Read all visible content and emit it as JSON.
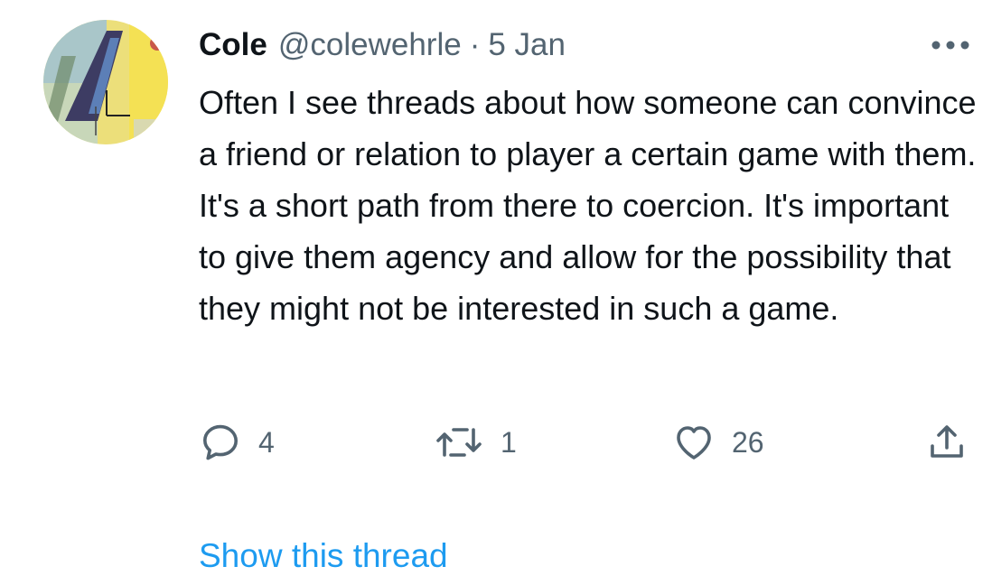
{
  "tweet": {
    "author_name": "Cole",
    "handle": "@colewehrle",
    "separator": "·",
    "timestamp": "5 Jan",
    "text": "Often I see threads about how someone can convince a friend or relation to player a certain game with them. It's a short path from there to coercion. It's important to give them agency and allow for the possibility that they might not be interested in such a game."
  },
  "actions": {
    "reply": {
      "icon": "reply-icon",
      "count": "4"
    },
    "retweet": {
      "icon": "retweet-icon",
      "count": "1"
    },
    "like": {
      "icon": "heart-icon",
      "count": "26"
    },
    "share": {
      "icon": "share-icon"
    }
  },
  "more_icon": "more-horizontal-icon",
  "show_thread_label": "Show this thread",
  "colors": {
    "text_primary": "#0f1419",
    "text_secondary": "#536471",
    "link_blue": "#1d9bf0"
  }
}
